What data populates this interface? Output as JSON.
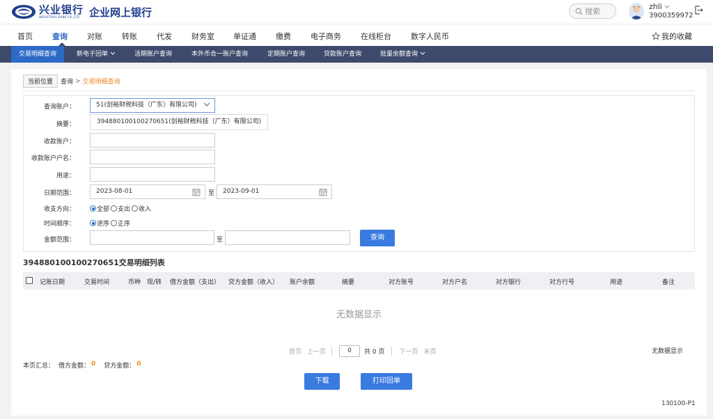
{
  "header": {
    "logo_cn": "兴业银行",
    "logo_en": "INDUSTRIAL BANK CO.,LTD",
    "product": "企业网上银行",
    "search_placeholder": "搜索",
    "user_name": "zhli",
    "user_id": "3900359972"
  },
  "mainnav": {
    "items": [
      "首页",
      "查询",
      "对账",
      "转账",
      "代发",
      "财务室",
      "单证通",
      "缴费",
      "电子商务",
      "在线柜台",
      "数字人民币"
    ],
    "favorites": "我的收藏"
  },
  "subnav": {
    "items": [
      "交易明细查询",
      "新电子回单",
      "活期账户查询",
      "本外币合一账户查询",
      "定期账户查询",
      "贷款账户查询",
      "批量余额查询"
    ]
  },
  "breadcrumb": {
    "current_label": "当前位置",
    "level1": "查询",
    "arrow": ">",
    "level2": "交易明细查询"
  },
  "form": {
    "account_label": "查询账户：",
    "account_value": "51(剑裕财税科技（广东）有限公司)",
    "summary_label": "摘要：",
    "suggestion": "394880100100270651(剑裕财税科技（广东）有限公司)",
    "payee_account_label": "收款账户：",
    "payee_name_label": "收款账户户名：",
    "purpose_label": "用途：",
    "date_label": "日期范围：",
    "date_from": "2023-08-01",
    "date_to_sep": "至",
    "date_to": "2023-09-01",
    "direction_label": "收支方向：",
    "direction_options": [
      "全部",
      "支出",
      "收入"
    ],
    "order_label": "时间顺序：",
    "order_options": [
      "逆序",
      "正序"
    ],
    "amount_label": "金额范围：",
    "amount_sep": "至",
    "query_button": "查询"
  },
  "table": {
    "title": "394880100100270651交易明细列表",
    "columns": [
      "记账日期",
      "交易时间",
      "币种",
      "现/转",
      "借方金额（支出）",
      "贷方金额（收入）",
      "账户余额",
      "摘要",
      "对方账号",
      "对方户名",
      "对方银行",
      "对方行号",
      "用途",
      "备注"
    ],
    "empty_text": "无数据显示"
  },
  "pager": {
    "first": "首页",
    "prev": "上一页",
    "page_value": "0",
    "total": "共 0 页",
    "next": "下一页",
    "last": "末页",
    "right_text": "无数据显示"
  },
  "summary": {
    "label": "本页汇总：",
    "debit_label": "借方金额：",
    "debit_value": "0",
    "credit_label": "贷方金额：",
    "credit_value": "0"
  },
  "actions": {
    "download": "下载",
    "print": "打印回单"
  },
  "version": "130100-P1",
  "colors": {
    "brand_blue": "#1f3f8c",
    "accent": "#3a7be0",
    "subnav_bg": "#3d4a6b",
    "highlight": "#f08a24"
  }
}
